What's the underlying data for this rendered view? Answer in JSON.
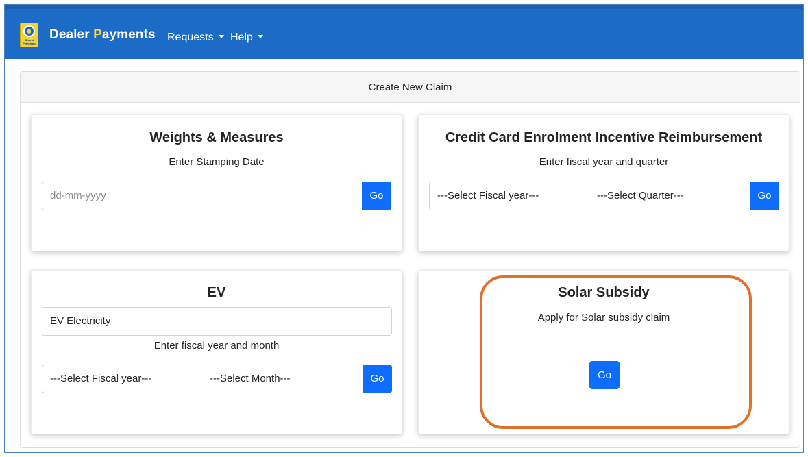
{
  "app": {
    "brand_part1": "Dealer ",
    "brand_part2": "P",
    "brand_part3": "ayments",
    "logo_text": "Bharat Petroleum",
    "nav": [
      {
        "label": "Requests"
      },
      {
        "label": "Help"
      }
    ]
  },
  "page": {
    "header": "Create New Claim"
  },
  "cards": {
    "weights_measures": {
      "title": "Weights & Measures",
      "subtitle": "Enter Stamping Date",
      "date_placeholder": "dd-mm-yyyy",
      "go_label": "Go"
    },
    "credit_card": {
      "title": "Credit Card Enrolment Incentive Reimbursement",
      "subtitle": "Enter fiscal year and quarter",
      "fiscal_year_select": "---Select Fiscal year---",
      "quarter_select": "---Select Quarter---",
      "go_label": "Go"
    },
    "ev": {
      "title": "EV",
      "type_value": "EV Electricity",
      "subtitle": "Enter fiscal year and month",
      "fiscal_year_select": "---Select Fiscal year---",
      "month_select": "---Select Month---",
      "go_label": "Go"
    },
    "solar": {
      "title": "Solar Subsidy",
      "subtitle": "Apply for Solar subsidy claim",
      "go_label": "Go"
    }
  },
  "colors": {
    "navbar": "#1c6bc6",
    "brand_accent": "#f6d53a",
    "primary_button": "#0d6efd",
    "highlight": "#e0702c"
  }
}
